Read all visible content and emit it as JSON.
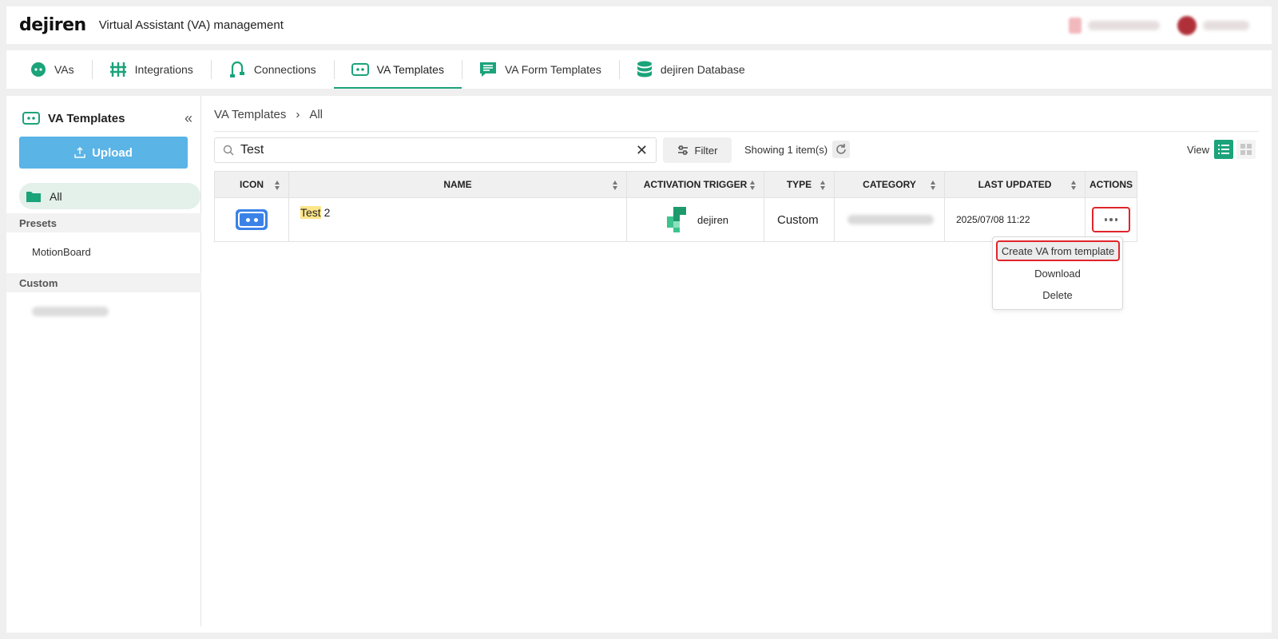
{
  "header": {
    "logo": "dejiren",
    "app_title": "Virtual Assistant (VA) management"
  },
  "tabs": [
    {
      "label": "VAs",
      "icon": "robot-face-icon"
    },
    {
      "label": "Integrations",
      "icon": "integrations-icon"
    },
    {
      "label": "Connections",
      "icon": "connections-icon"
    },
    {
      "label": "VA Templates",
      "icon": "va-template-icon",
      "active": true
    },
    {
      "label": "VA Form Templates",
      "icon": "form-template-icon"
    },
    {
      "label": "dejiren Database",
      "icon": "database-icon"
    }
  ],
  "sidebar": {
    "title": "VA Templates",
    "upload_label": "Upload",
    "all_label": "All",
    "presets_label": "Presets",
    "preset_items": [
      "MotionBoard"
    ],
    "custom_label": "Custom"
  },
  "breadcrumb": {
    "root": "VA Templates",
    "separator": "›",
    "current": "All"
  },
  "search": {
    "value": "Test"
  },
  "toolbar": {
    "filter_label": "Filter",
    "showing_text": "Showing 1 item(s)",
    "view_label": "View"
  },
  "table": {
    "columns": [
      "ICON",
      "NAME",
      "ACTIVATION TRIGGER",
      "TYPE",
      "CATEGORY",
      "LAST UPDATED",
      "ACTIONS"
    ],
    "rows": [
      {
        "name_highlight": "Test",
        "name_rest": " 2",
        "trigger": "dejiren",
        "type": "Custom",
        "last_updated": "2025/07/08 11:22"
      }
    ]
  },
  "actions_menu": {
    "items": [
      "Create VA from template",
      "Download",
      "Delete"
    ]
  },
  "colors": {
    "accent": "#1ba37a",
    "upload_button": "#5ab4e6",
    "highlight_border": "#e0252b",
    "va_icon": "#3b82e8"
  }
}
